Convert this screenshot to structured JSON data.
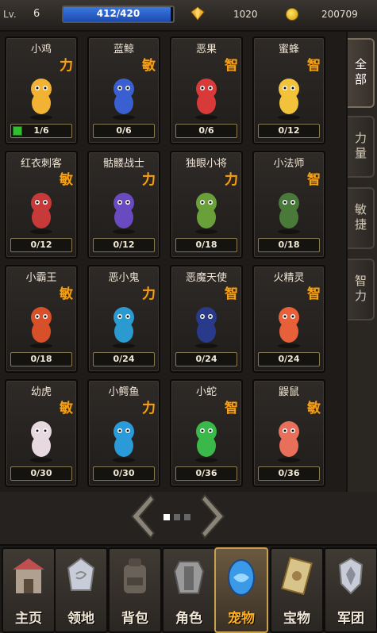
{
  "player": {
    "level_label": "Lv.",
    "level": "6",
    "exp_text": "412/420",
    "exp_fraction": 0.981
  },
  "resources": {
    "gems": "1020",
    "coins": "200709"
  },
  "pets": [
    {
      "name": "小鸡",
      "type": "力",
      "progress": "1/6",
      "color": "#f2b233"
    },
    {
      "name": "蓝鲸",
      "type": "敏",
      "progress": "0/6",
      "color": "#3a5fd0"
    },
    {
      "name": "恶果",
      "type": "智",
      "progress": "0/6",
      "color": "#d83a3a"
    },
    {
      "name": "蜜蜂",
      "type": "智",
      "progress": "0/12",
      "color": "#f2c23a"
    },
    {
      "name": "红衣刺客",
      "type": "敏",
      "progress": "0/12",
      "color": "#c83a3a"
    },
    {
      "name": "骷髅战士",
      "type": "力",
      "progress": "0/12",
      "color": "#6a4ac0"
    },
    {
      "name": "独眼小将",
      "type": "力",
      "progress": "0/18",
      "color": "#6aa03a"
    },
    {
      "name": "小法师",
      "type": "智",
      "progress": "0/18",
      "color": "#4a7a3a"
    },
    {
      "name": "小霸王",
      "type": "敏",
      "progress": "0/18",
      "color": "#d8502a"
    },
    {
      "name": "恶小鬼",
      "type": "力",
      "progress": "0/24",
      "color": "#2a9ad0"
    },
    {
      "name": "恶魔天使",
      "type": "智",
      "progress": "0/24",
      "color": "#2a3a8a"
    },
    {
      "name": "火精灵",
      "type": "智",
      "progress": "0/24",
      "color": "#e8603a"
    },
    {
      "name": "幼虎",
      "type": "敏",
      "progress": "0/30",
      "color": "#e8d8e0"
    },
    {
      "name": "小鳄鱼",
      "type": "力",
      "progress": "0/30",
      "color": "#2a9ad8"
    },
    {
      "name": "小蛇",
      "type": "智",
      "progress": "0/36",
      "color": "#3ab84a"
    },
    {
      "name": "鼹鼠",
      "type": "敏",
      "progress": "0/36",
      "color": "#e8705a"
    }
  ],
  "side_tabs": [
    {
      "label": "全部"
    },
    {
      "label": "力量"
    },
    {
      "label": "敏捷"
    },
    {
      "label": "智力"
    }
  ],
  "nav": [
    {
      "label": "主页",
      "icon": "shop-icon"
    },
    {
      "label": "领地",
      "icon": "stone-icon"
    },
    {
      "label": "背包",
      "icon": "backpack-icon"
    },
    {
      "label": "角色",
      "icon": "armor-icon"
    },
    {
      "label": "宠物",
      "icon": "egg-icon"
    },
    {
      "label": "宝物",
      "icon": "scroll-icon"
    },
    {
      "label": "军团",
      "icon": "emblem-icon"
    }
  ]
}
